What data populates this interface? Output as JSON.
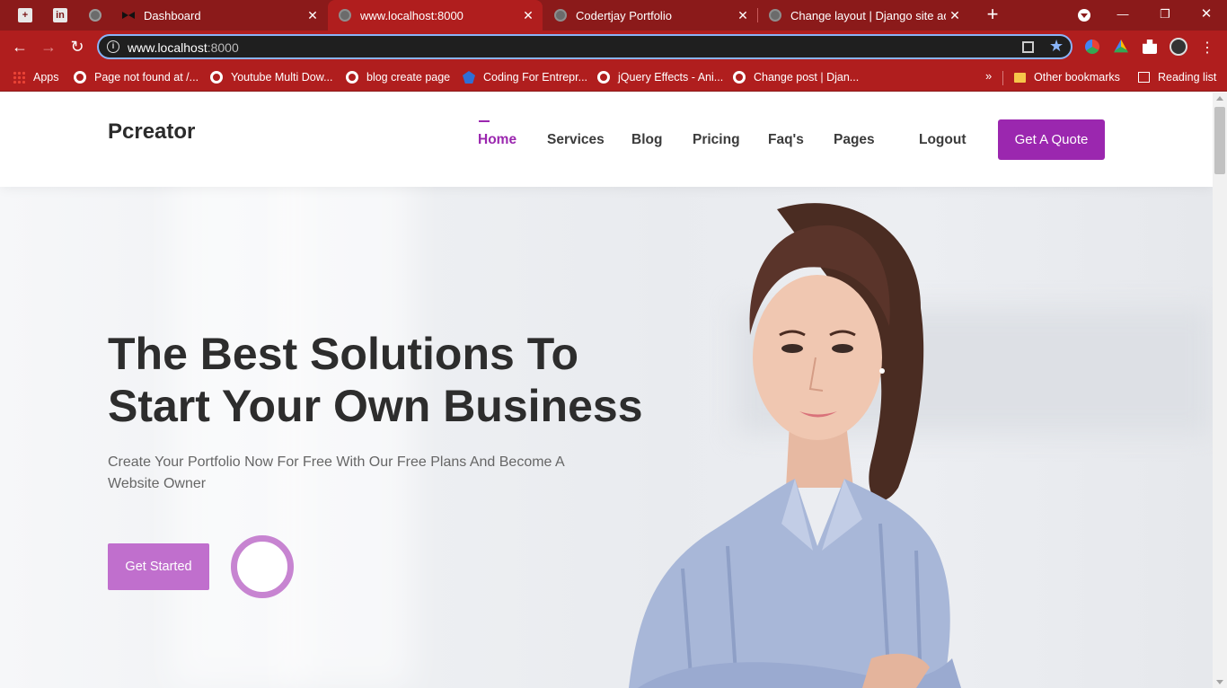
{
  "browser": {
    "tabs": [
      {
        "title": "Dashboard",
        "icon": "bowtie-icon",
        "active": false
      },
      {
        "title": "www.localhost:8000",
        "icon": "globe-icon",
        "active": true
      },
      {
        "title": "Codertjay Portfolio",
        "icon": "globe-icon",
        "active": false
      },
      {
        "title": "Change layout | Django site adm",
        "icon": "globe-icon",
        "active": false
      }
    ],
    "address": {
      "host": "www.localhost",
      "port": ":8000"
    },
    "bookmarks": [
      {
        "label": "Apps",
        "icon": "apps-grid-icon"
      },
      {
        "label": "Page not found at /...",
        "icon": "globe-icon"
      },
      {
        "label": "Youtube Multi Dow...",
        "icon": "globe-icon"
      },
      {
        "label": "blog create page",
        "icon": "globe-icon"
      },
      {
        "label": "Coding For Entrepr...",
        "icon": "fox-icon"
      },
      {
        "label": "jQuery Effects - Ani...",
        "icon": "globe-icon"
      },
      {
        "label": "Change post | Djan...",
        "icon": "globe-icon"
      }
    ],
    "more_bookmarks": "»",
    "other_bookmarks": "Other bookmarks",
    "reading_list": "Reading list"
  },
  "site": {
    "logo": "Pcreator",
    "nav": {
      "home": "Home",
      "services": "Services",
      "blog": "Blog",
      "pricing": "Pricing",
      "faqs": "Faq's",
      "pages": "Pages ",
      "logout": "Logout"
    },
    "quote_button": "Get A Quote",
    "accent_color": "#9b27af"
  },
  "hero": {
    "headline_line1": "The Best Solutions To",
    "headline_line2": "Start Your Own Business",
    "subtext": "Create Your Portfolio Now For Free With Our Free Plans And Become A Website Owner",
    "cta": "Get Started",
    "play_glyph": ""
  }
}
